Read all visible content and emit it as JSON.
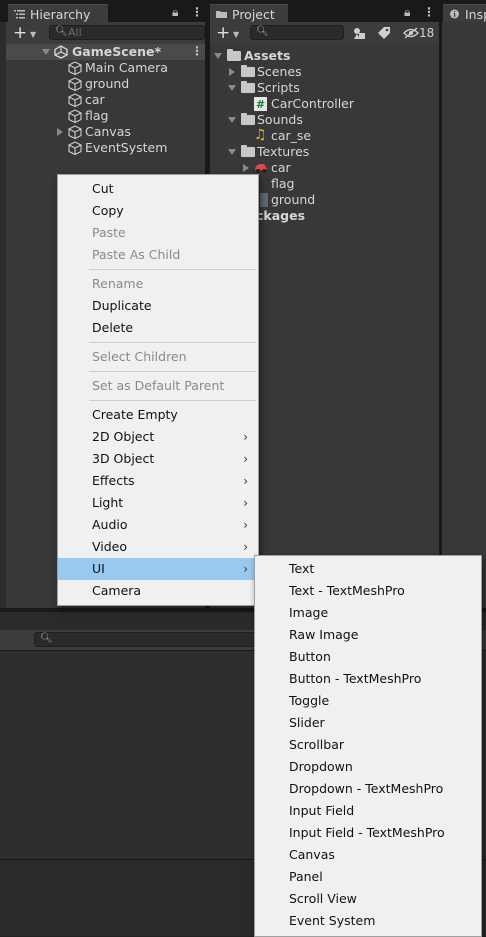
{
  "hierarchy": {
    "tab_label": "Hierarchy",
    "search_placeholder": "All",
    "scene_name": "GameScene*",
    "items": [
      "Main Camera",
      "ground",
      "car",
      "flag",
      "Canvas",
      "EventSystem"
    ]
  },
  "project": {
    "tab_label": "Project",
    "hidden_count": "18",
    "tree": {
      "assets": "Assets",
      "scenes": "Scenes",
      "scripts": "Scripts",
      "car_controller": "CarController",
      "sounds": "Sounds",
      "car_se": "car_se",
      "textures": "Textures",
      "car": "car",
      "flag": "flag",
      "ground": "ground",
      "packages_partial": "ckages"
    }
  },
  "inspector": {
    "tab_label": "Insp"
  },
  "context_menu": {
    "items": [
      {
        "label": "Cut",
        "disabled": false
      },
      {
        "label": "Copy",
        "disabled": false
      },
      {
        "label": "Paste",
        "disabled": true
      },
      {
        "label": "Paste As Child",
        "disabled": true
      },
      {
        "label": "Rename",
        "disabled": true
      },
      {
        "label": "Duplicate",
        "disabled": false
      },
      {
        "label": "Delete",
        "disabled": false
      },
      {
        "label": "Select Children",
        "disabled": true
      },
      {
        "label": "Set as Default Parent",
        "disabled": true
      },
      {
        "label": "Create Empty",
        "disabled": false
      },
      {
        "label": "2D Object",
        "disabled": false,
        "submenu": true
      },
      {
        "label": "3D Object",
        "disabled": false,
        "submenu": true
      },
      {
        "label": "Effects",
        "disabled": false,
        "submenu": true
      },
      {
        "label": "Light",
        "disabled": false,
        "submenu": true
      },
      {
        "label": "Audio",
        "disabled": false,
        "submenu": true
      },
      {
        "label": "Video",
        "disabled": false,
        "submenu": true
      },
      {
        "label": "UI",
        "disabled": false,
        "submenu": true,
        "selected": true
      },
      {
        "label": "Camera",
        "disabled": false
      }
    ]
  },
  "ui_submenu": {
    "items": [
      "Text",
      "Text - TextMeshPro",
      "Image",
      "Raw Image",
      "Button",
      "Button - TextMeshPro",
      "Toggle",
      "Slider",
      "Scrollbar",
      "Dropdown",
      "Dropdown - TextMeshPro",
      "Input Field",
      "Input Field - TextMeshPro",
      "Canvas",
      "Panel",
      "Scroll View",
      "Event System"
    ]
  },
  "colors": {
    "selected_item": "#99c9ef",
    "panel_bg": "#383838",
    "tab_strip": "#191919"
  },
  "icons": [
    "hierarchy-list-icon",
    "folder-icon",
    "lock-icon",
    "kebab-menu-icon",
    "plus-icon",
    "search-icon",
    "unity-logo-icon",
    "gameobject-cube-icon",
    "csharp-script-icon",
    "audio-clip-icon",
    "car-sprite-icon",
    "texture-icon",
    "tag-icon",
    "hidden-eye-icon",
    "chevron-right-icon",
    "info-icon"
  ]
}
